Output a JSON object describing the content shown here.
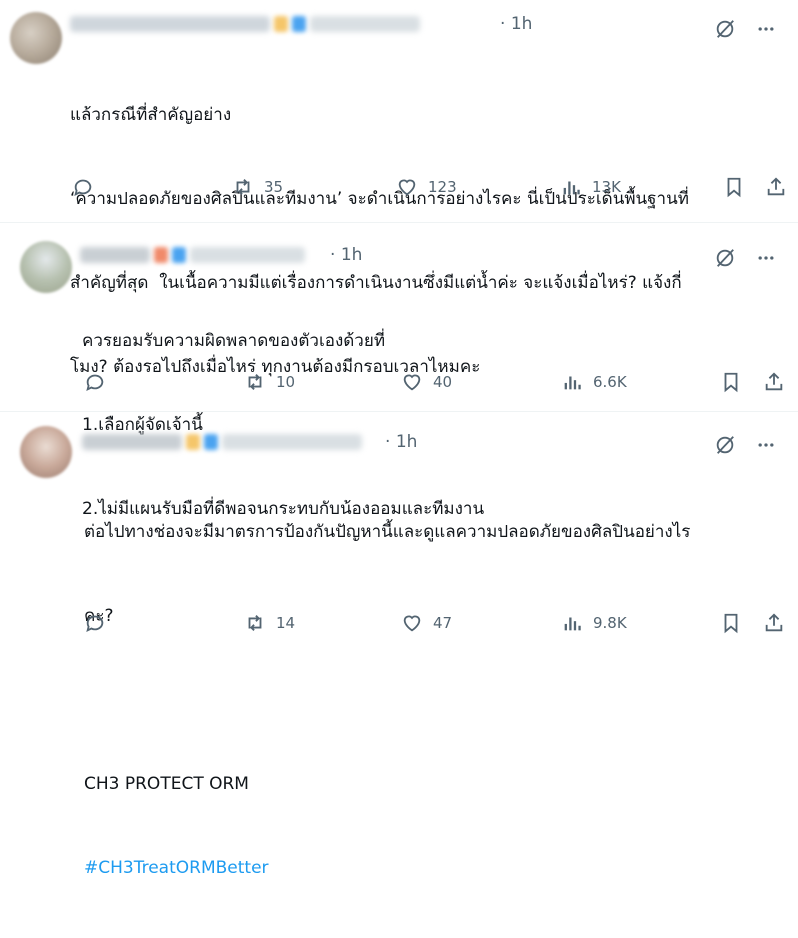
{
  "posts": [
    {
      "time": "1h",
      "lines": [
        "แล้วกรณีที่สำคัญอย่าง",
        "‘ความปลอดภัยของศิลปินและทีมงาน’ จะดำเนินการอย่างไรคะ นี่เป็นประเด็นพื้นฐานที่",
        "สำคัญที่สุด  ในเนื้อความมีแต่เรื่องการดำเนินงานซึ่งมีแต่น้ำค่ะ จะแจ้งเมื่อไหร่? แจ้งกี่",
        "โมง? ต้องรอไปถึงเมื่อไหร่ ทุกงานต้องมีกรอบเวลาไหมคะ"
      ],
      "reposts": "35",
      "likes": "123",
      "views": "13K"
    },
    {
      "time": "1h",
      "lines": [
        "ควรยอมรับความผิดพลาดของตัวเองด้วยที่",
        "1.เลือกผู้จัดเจ้านี้",
        "2.ไม่มีแผนรับมือที่ดีพอจนกระทบกับน้องออมและทีมงาน"
      ],
      "reposts": "10",
      "likes": "40",
      "views": "6.6K"
    },
    {
      "time": "1h",
      "lines": [
        "ต่อไปทางช่องจะมีมาตรการป้องกันปัญหานี้และดูแลความปลอดภัยของศิลปินอย่างไร",
        "คะ?",
        "",
        "CH3 PROTECT ORM"
      ],
      "hashtag": "#CH3TreatORMBetter",
      "reposts": "14",
      "likes": "47",
      "views": "9.8K"
    }
  ],
  "icons": {
    "reply": "reply-icon",
    "repost": "repost-icon",
    "like": "like-icon",
    "views": "views-icon",
    "bookmark": "bookmark-icon",
    "share": "share-icon",
    "grok": "grok-icon",
    "more": "more-icon"
  },
  "colors": {
    "text": "#0f1419",
    "muted": "#536471",
    "link": "#1d9bf0",
    "divider": "#eff3f4"
  }
}
